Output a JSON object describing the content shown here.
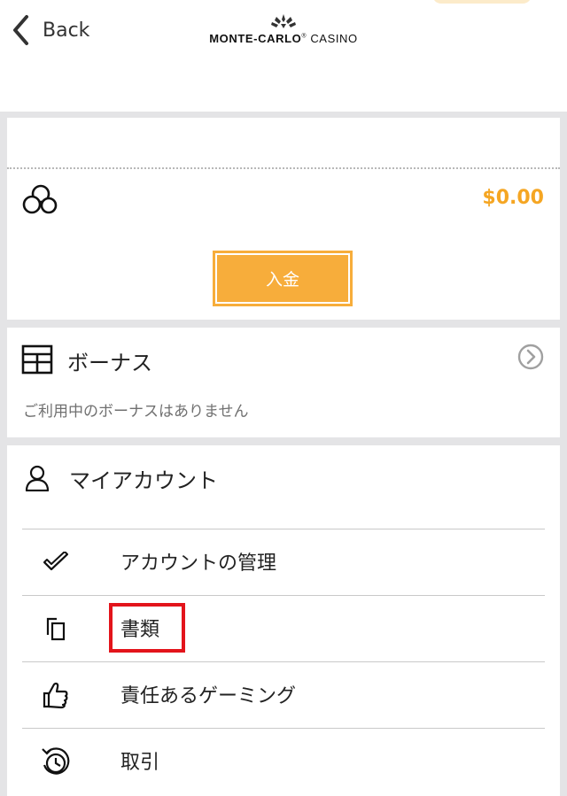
{
  "header": {
    "back_label": "Back",
    "logo_primary": "MONTE-CARLO",
    "logo_registered": "®",
    "logo_secondary": "CASINO"
  },
  "wallet": {
    "balance": "$0.00",
    "deposit_label": "入金",
    "accent_color": "#f7ad3b"
  },
  "bonus": {
    "title": "ボーナス",
    "empty_text": "ご利用中のボーナスはありません"
  },
  "account": {
    "title": "マイアカウント",
    "items": [
      {
        "label": "アカウントの管理",
        "icon": "checkmark-icon"
      },
      {
        "label": "書類",
        "icon": "documents-icon",
        "highlighted": true
      },
      {
        "label": "責任あるゲーミング",
        "icon": "thumbs-up-icon"
      },
      {
        "label": "取引",
        "icon": "history-clock-icon"
      }
    ]
  },
  "colors": {
    "highlight": "#e3141b",
    "balance": "#f5a623"
  }
}
